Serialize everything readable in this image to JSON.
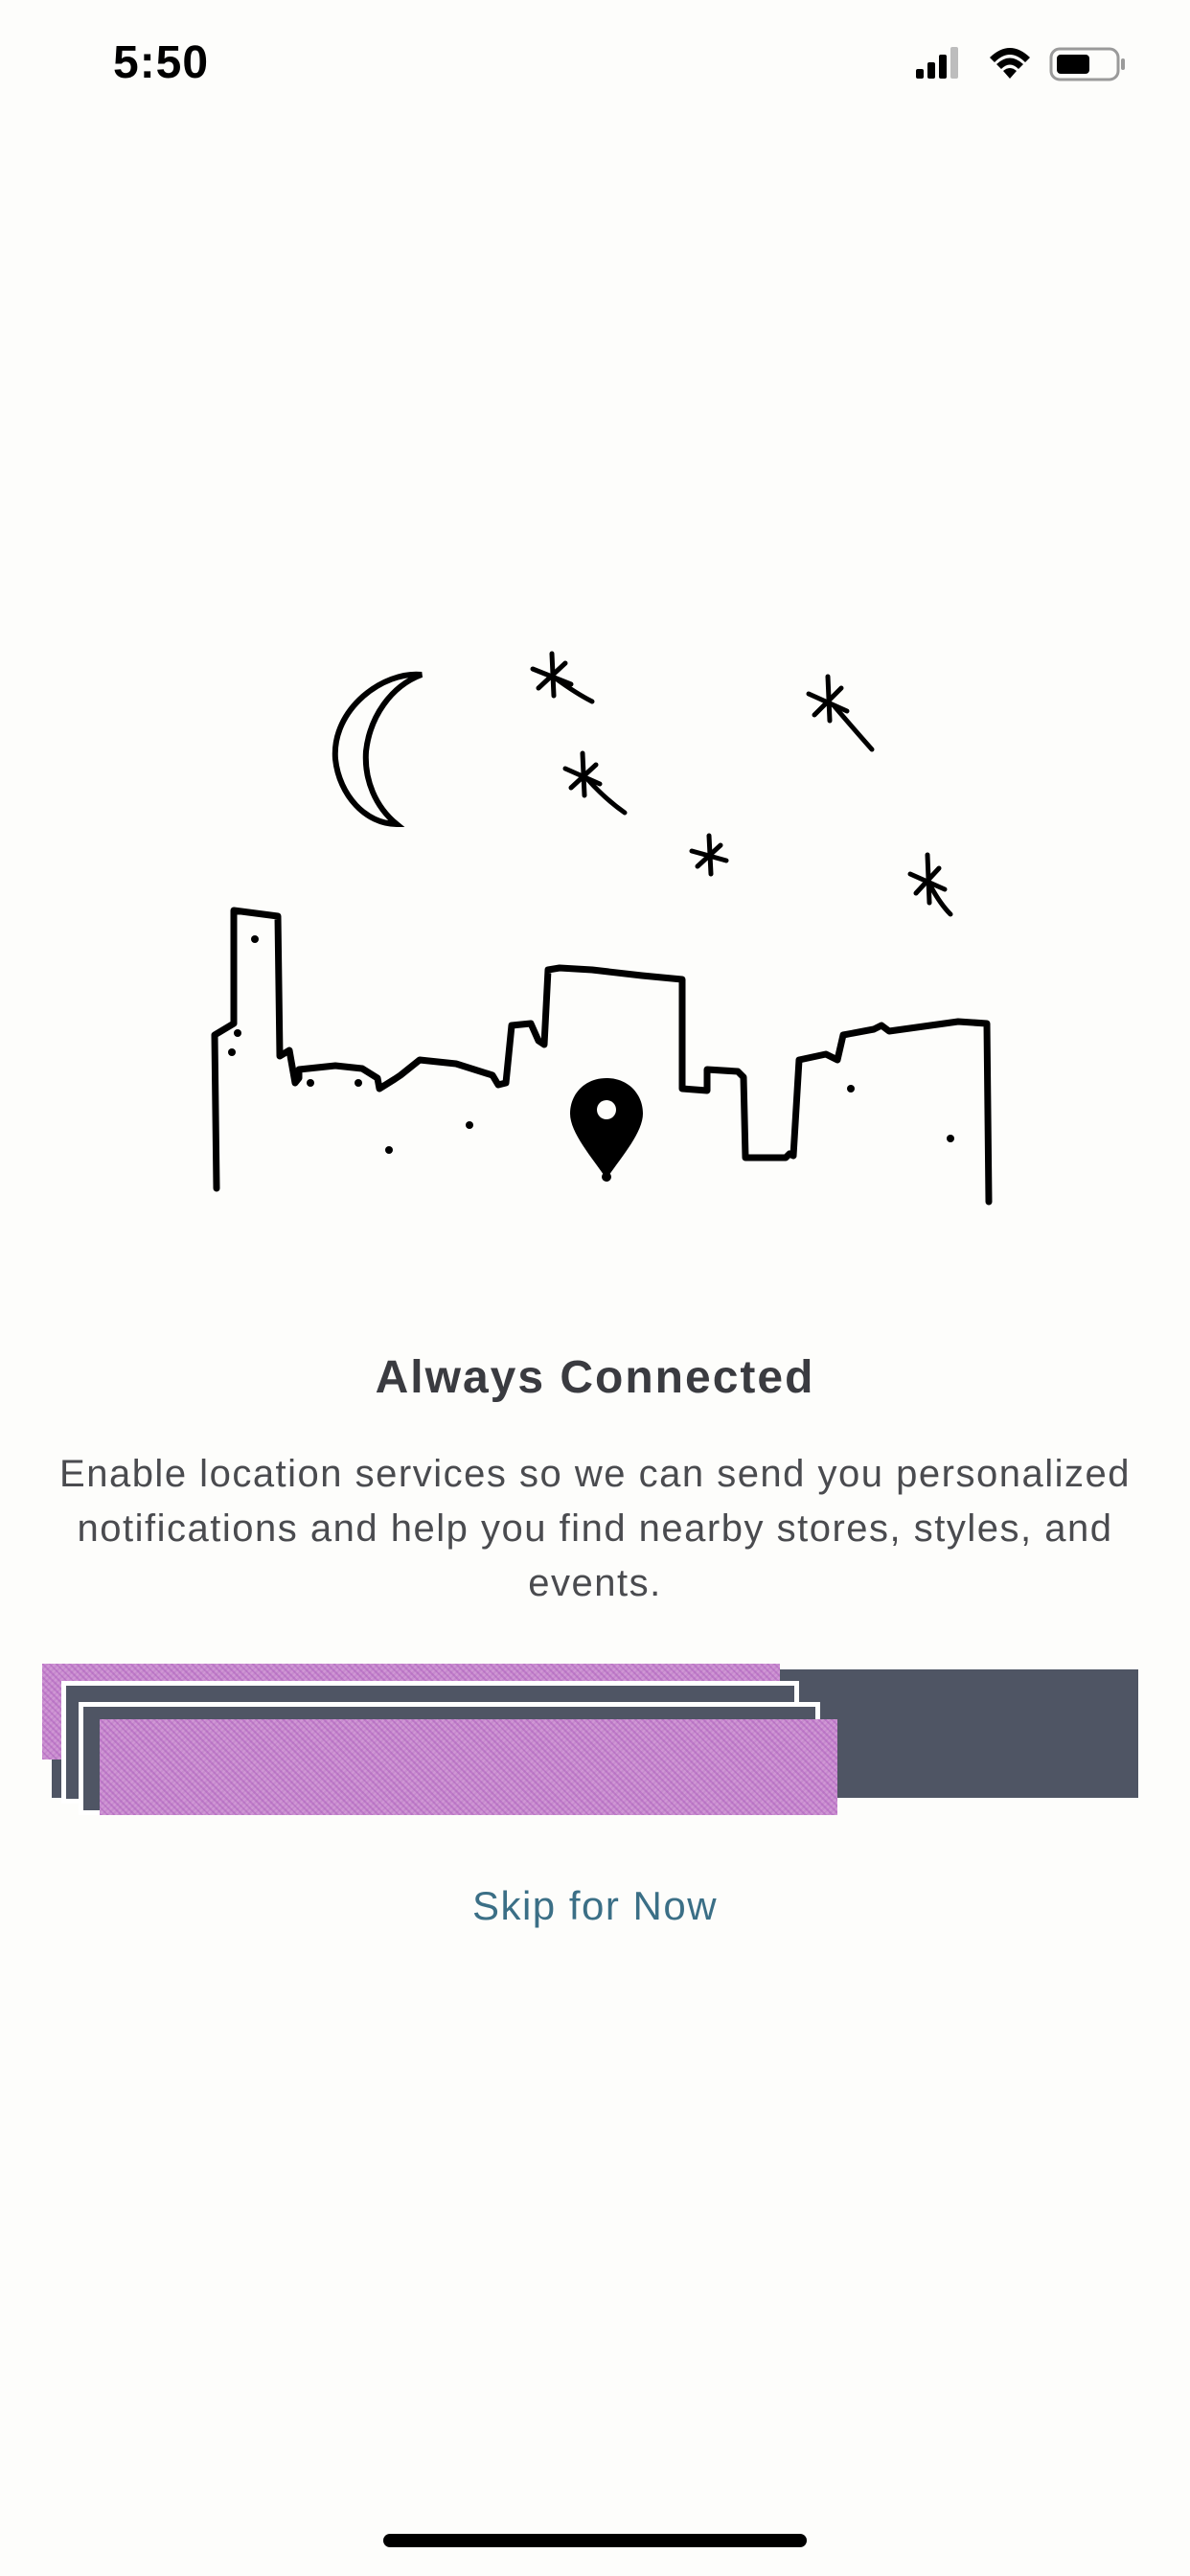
{
  "status_bar": {
    "time": "5:50"
  },
  "illustration": {
    "description_icon": "city-skyline-night-location-illustration"
  },
  "content": {
    "title": "Always Connected",
    "description": "Enable location services so we can send you personalized notifications and help you find nearby stores, styles, and events."
  },
  "actions": {
    "primary_button_label": "",
    "skip_label": "Skip for Now"
  },
  "colors": {
    "background": "#fdfdfb",
    "button": "#4f5564",
    "link": "#3b6f86",
    "title": "#3a3b40"
  }
}
